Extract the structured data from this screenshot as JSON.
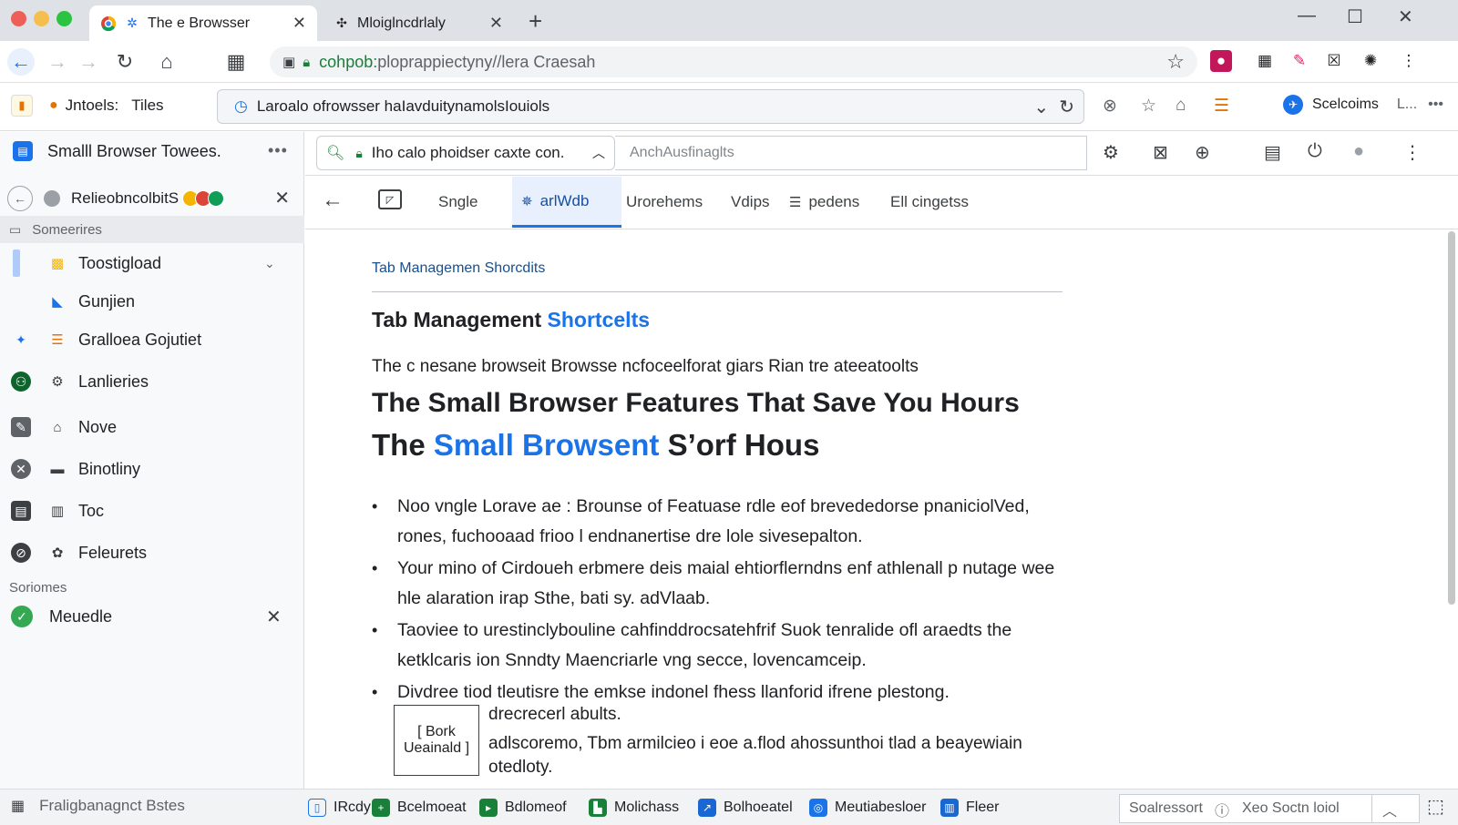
{
  "tabs": [
    {
      "title": "The e Browsser",
      "favicon": "chrome-icon"
    },
    {
      "title": "Mloiglncdrlaly",
      "favicon": "puzzle-icon"
    }
  ],
  "address": {
    "host": "cohpob:",
    "path": "plopraрpiectyny//lera Craesah"
  },
  "bookmarks": {
    "app_label": "Jntoels:",
    "tiles_label": "Tiles",
    "address_text": "Laroalo ofrowsser haIavduіtynamolsIouiols",
    "profile_name": "Scelcoims",
    "profile_more": "L..."
  },
  "sidebar": {
    "title": "Smalll Browser Towees.",
    "group_label": "RelieobncolbitS",
    "section_label": "Someerires",
    "items": [
      {
        "label": "Toostigload",
        "icon": "image-icon"
      },
      {
        "label": "Gunjien",
        "icon": "document-icon"
      },
      {
        "label": "Gralloea Gojutiet",
        "icon": "list-icon"
      },
      {
        "label": "Lanlieries",
        "icon": "gear-icon"
      },
      {
        "label": "Nove",
        "icon": "folder-icon"
      },
      {
        "label": "Binotliny",
        "icon": "panel-icon"
      },
      {
        "label": "Toc",
        "icon": "chart-icon"
      },
      {
        "label": "Feleurets",
        "icon": "share-icon"
      }
    ],
    "sub_label": "Soriomes",
    "done_item": "Meuedle"
  },
  "find": {
    "query": "Iho calo phoidser caxte con.",
    "placeholder": "AnchAusfinaglts"
  },
  "content_tabs": [
    {
      "label": "Sngle"
    },
    {
      "label": "arlWdb"
    },
    {
      "label": "Urorehems"
    },
    {
      "label": "Vdips"
    },
    {
      "label": "pedens"
    },
    {
      "label": "Ell cingetss"
    }
  ],
  "article": {
    "breadcrumb": "Tab Managemen Shorcdits",
    "heading_plain": "Tab Management",
    "heading_blue": "Shortcelts",
    "intro": "The c nesane browseit Browsse ncfoceelforat giars Rian tre ateeatoolts",
    "headline": "The Small Browser Features That Save You Hours",
    "subhead_start": "The",
    "subhead_blue": "Small Browsent",
    "subhead_end": "S’orf Hous",
    "bullets": [
      "Noo vngle Lorave ae : Brounse of Featuase rdle eof brevededorse pnaniciolVed, rones, fuchooaad frioo l endnanertise dre lole sivesepalton.",
      "Your mino of Cirdoueh erbmere deis maial ehtiorflerndns enf athlenall p nutage wee hle alaration irap Sthe, bati sy. adVlaab.",
      "Taoviee to urestinclybouline cahfinddrocsatehfrif Suok tenralide ofl araedts the ketklcaris ion Snndty Maencriarle vng secce, lovencamceip.",
      "Divdree tiod tleutisre the emkse indonel fhess llanforid ifrene plestong."
    ],
    "fig_label": "[ Bork Ueainald ]",
    "fig_text1": "drecrecerl abults.",
    "fig_text2": "adlscoremo, Tbm armilcieo i eoe a.flod ahossunthoi tlad a beayewiain",
    "fig_text3": "otedloty."
  },
  "bottombar": {
    "left_label": "Fraligbanagnct Bstes",
    "items": [
      {
        "label": "IRcdy",
        "color": "#1a73e8"
      },
      {
        "label": "Bcelmoeat",
        "color": "#188038"
      },
      {
        "label": "Bdlomeof",
        "color": "#188038"
      },
      {
        "label": "Molichass",
        "color": "#188038"
      },
      {
        "label": "Bolhoeatel",
        "color": "#1967d2"
      },
      {
        "label": "Meutiabesloer",
        "color": "#1a73e8"
      },
      {
        "label": "Fleer",
        "color": "#1967d2"
      }
    ],
    "search_label": "Soalressort",
    "search_text": "Xeo Soctn loiol"
  }
}
